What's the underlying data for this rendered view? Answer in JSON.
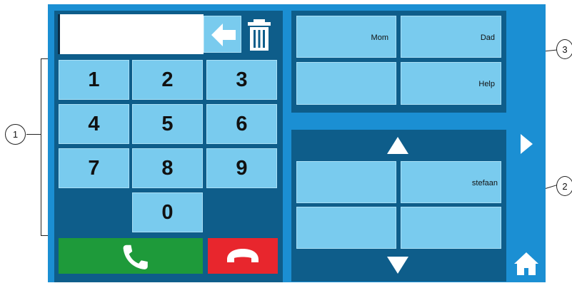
{
  "keypad": {
    "display_value": "",
    "keys": [
      "1",
      "2",
      "3",
      "4",
      "5",
      "6",
      "7",
      "8",
      "9",
      "0"
    ]
  },
  "favorites": {
    "labels": [
      "Mom",
      "Dad",
      "",
      "Help"
    ]
  },
  "contacts": {
    "labels": [
      "",
      "stefaan",
      "",
      ""
    ]
  },
  "callouts": [
    "1",
    "2",
    "3"
  ],
  "colors": {
    "screen_bg": "#1b8fd3",
    "panel_bg": "#0e5d8a",
    "key_bg": "#79cbee",
    "call_green": "#1e9a3a",
    "hangup_red": "#e8262d"
  }
}
